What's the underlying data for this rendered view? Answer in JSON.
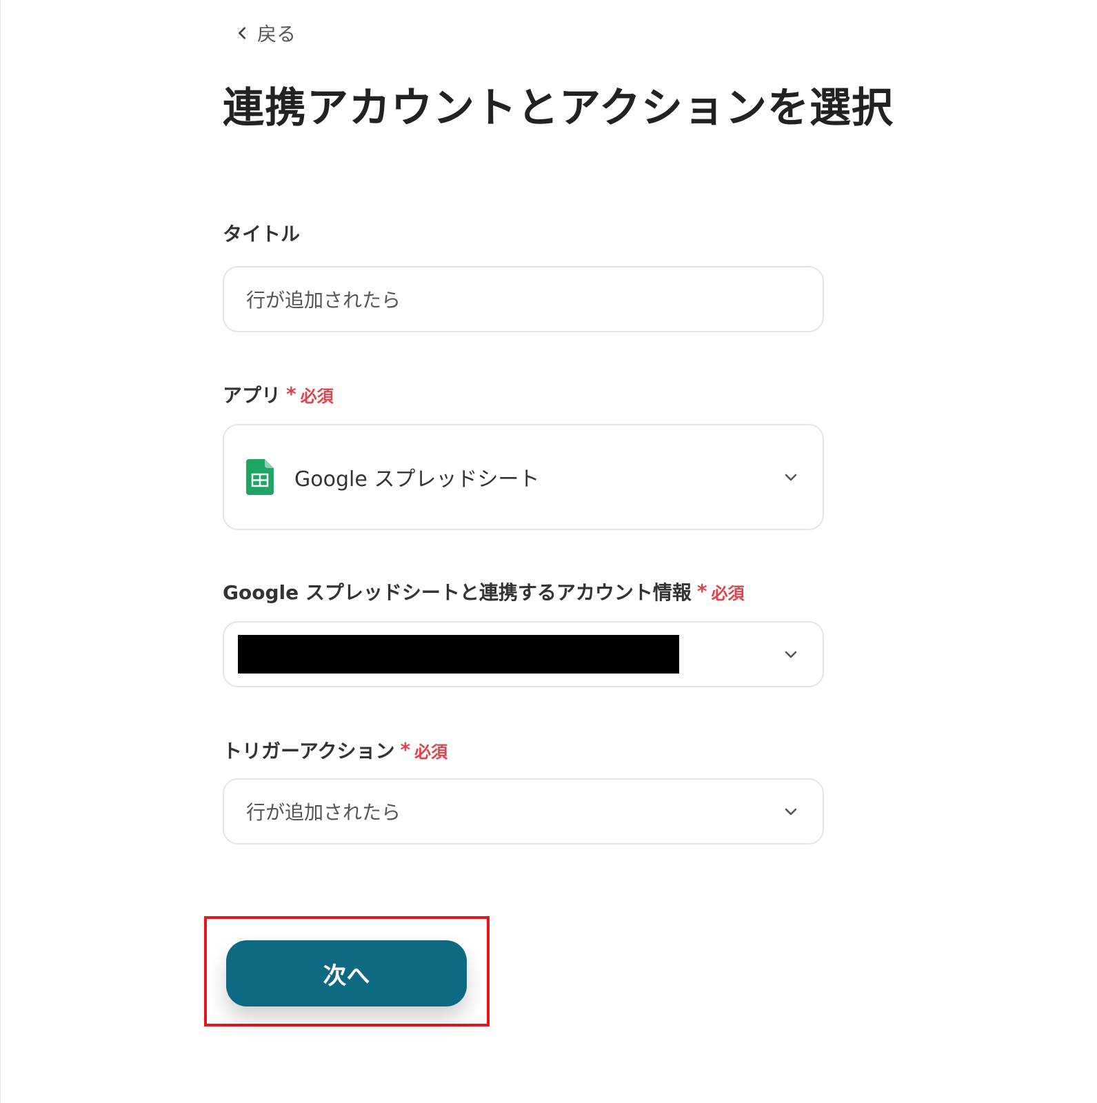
{
  "back": {
    "label": "戻る",
    "icon": "chevron-left-icon"
  },
  "page_title": "連携アカウントとアクションを選択",
  "title_field": {
    "label": "タイトル",
    "value": "行が追加されたら"
  },
  "app_field": {
    "label": "アプリ",
    "required": "必須",
    "value": "Google スプレッドシート",
    "icon": "google-sheets-icon"
  },
  "account_field": {
    "label": "Google スプレッドシートと連携するアカウント情報",
    "required": "必須"
  },
  "trigger_field": {
    "label": "トリガーアクション",
    "required": "必須",
    "value": "行が追加されたら"
  },
  "next_button": {
    "label": "次へ"
  },
  "colors": {
    "accent": "#0d6a82",
    "required": "#e2414c",
    "highlight": "#e8131b"
  }
}
